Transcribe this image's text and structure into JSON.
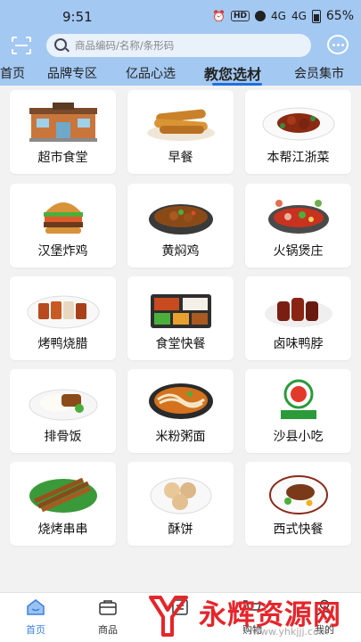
{
  "status_bar": {
    "time": "9:51",
    "hd_badge": "HD",
    "signal": "4G",
    "battery": "65%"
  },
  "header": {
    "search": {
      "placeholder": "商品编码/名称/条形码"
    },
    "tabs": [
      {
        "label": "首页"
      },
      {
        "label": "品牌专区"
      },
      {
        "label": "亿品心选"
      },
      {
        "label": "教您选材",
        "active": true
      },
      {
        "label": "会员集市"
      }
    ]
  },
  "categories": [
    {
      "label": "超市食堂",
      "icon": "supermarket-canteen"
    },
    {
      "label": "早餐",
      "icon": "breakfast"
    },
    {
      "label": "本帮江浙菜",
      "icon": "jiangzhe-cuisine"
    },
    {
      "label": "汉堡炸鸡",
      "icon": "burger-fried-chicken"
    },
    {
      "label": "黄焖鸡",
      "icon": "braised-chicken"
    },
    {
      "label": "火锅煲庄",
      "icon": "hot-pot"
    },
    {
      "label": "烤鸭烧腊",
      "icon": "roast-duck"
    },
    {
      "label": "食堂快餐",
      "icon": "canteen-fast-food"
    },
    {
      "label": "卤味鸭脖",
      "icon": "braised-duck-neck"
    },
    {
      "label": "排骨饭",
      "icon": "pork-rib-rice"
    },
    {
      "label": "米粉粥面",
      "icon": "rice-noodles"
    },
    {
      "label": "沙县小吃",
      "icon": "shaxian-snacks"
    },
    {
      "label": "烧烤串串",
      "icon": "bbq-skewers"
    },
    {
      "label": "酥饼",
      "icon": "pastry"
    },
    {
      "label": "西式快餐",
      "icon": "western-fast-food"
    }
  ],
  "bottom_nav": [
    {
      "label": "首页",
      "icon": "home-icon",
      "active": true
    },
    {
      "label": "商品",
      "icon": "bag-icon"
    },
    {
      "label": "",
      "icon": "list-icon"
    },
    {
      "label": "购物",
      "icon": "cart-icon"
    },
    {
      "label": "我的",
      "icon": "user-icon"
    }
  ],
  "watermark": {
    "text": "永辉资源网",
    "url": "www.yhkjjj.com"
  },
  "colors": {
    "header_bg": "#a3c8f2",
    "accent": "#1e6fe0",
    "watermark": "#e5252a"
  }
}
